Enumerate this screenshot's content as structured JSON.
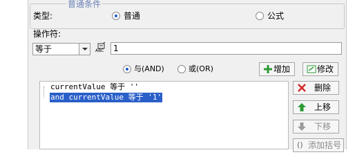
{
  "group": {
    "title": "普通条件"
  },
  "type_row": {
    "label": "类型:",
    "option_normal": "普通",
    "option_formula": "公式",
    "selected": "普通"
  },
  "operator": {
    "label": "操作符:",
    "select_value": "等于",
    "value_text": "1",
    "icon_caption": "ABC"
  },
  "logic": {
    "and_label": "与(AND)",
    "or_label": "或(OR)",
    "selected": "与(AND)"
  },
  "buttons": {
    "add": "增加",
    "modify": "修改",
    "delete": "删除",
    "move_up": "上移",
    "move_down": "下移",
    "add_bracket": "添加括号"
  },
  "conditions": [
    {
      "text": "currentValue 等于 ''",
      "selected": false
    },
    {
      "text": "and currentValue 等于 '1'",
      "selected": true
    }
  ],
  "colors": {
    "selection": "#2a5fc9",
    "group_title": "#6a82b6",
    "add_icon": "#2e9a35",
    "delete_icon": "#d12a2a",
    "up_icon": "#2e9a35",
    "down_icon_disabled": "#9a9a9a"
  }
}
